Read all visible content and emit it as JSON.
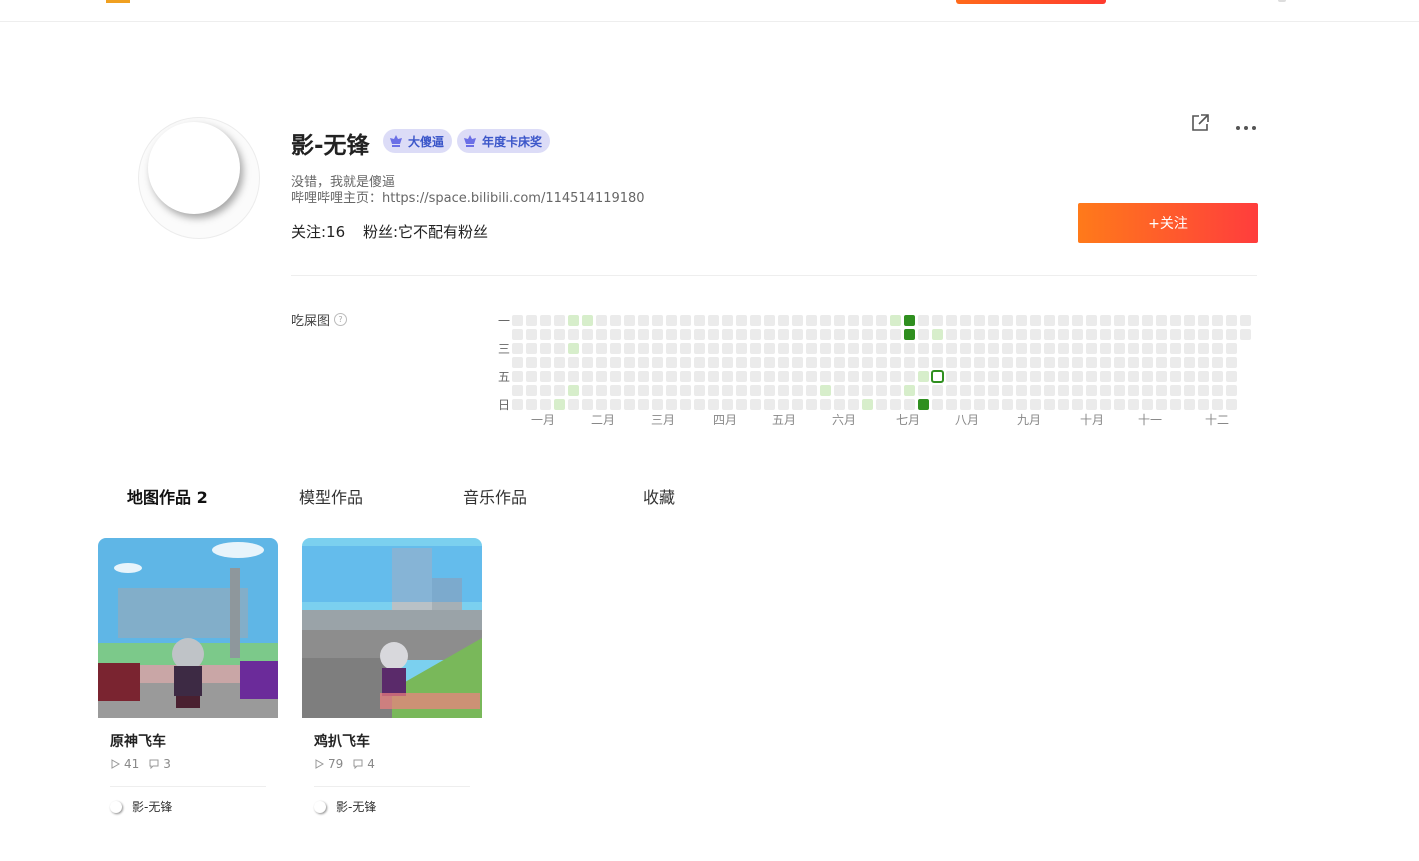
{
  "profile": {
    "username": "影-无锋",
    "badges": [
      "大傻逼",
      "年度卡床奖"
    ],
    "bio": "没错，我就是傻逼",
    "homepage": "哔哩哔哩主页：https://space.bilibili.com/114514119180",
    "following": "关注:16",
    "followers": "粉丝:它不配有粉丝"
  },
  "actions": {
    "follow_label": "+关注",
    "share_icon": "share-icon",
    "more_icon": "more-icon"
  },
  "heatmap": {
    "title": "吃屎图",
    "weekday_labels": [
      "一",
      "三",
      "五",
      "日"
    ],
    "month_labels": [
      "一月",
      "二月",
      "三月",
      "四月",
      "五月",
      "六月",
      "七月",
      "八月",
      "九月",
      "十月",
      "十一",
      "十二"
    ],
    "colors": {
      "empty": "#ebebeb",
      "light": "#d7eecb",
      "dark": "#2f8f1f"
    },
    "cells": [
      {
        "week": 4,
        "day": 0,
        "level": "light"
      },
      {
        "week": 5,
        "day": 0,
        "level": "light"
      },
      {
        "week": 4,
        "day": 2,
        "level": "light"
      },
      {
        "week": 4,
        "day": 5,
        "level": "light"
      },
      {
        "week": 3,
        "day": 6,
        "level": "light"
      },
      {
        "week": 22,
        "day": 5,
        "level": "light"
      },
      {
        "week": 25,
        "day": 6,
        "level": "light"
      },
      {
        "week": 27,
        "day": 0,
        "level": "light"
      },
      {
        "week": 28,
        "day": 0,
        "level": "dark"
      },
      {
        "week": 28,
        "day": 1,
        "level": "dark"
      },
      {
        "week": 30,
        "day": 1,
        "level": "light"
      },
      {
        "week": 29,
        "day": 4,
        "level": "light"
      },
      {
        "week": 30,
        "day": 4,
        "level": "today"
      },
      {
        "week": 28,
        "day": 5,
        "level": "light"
      },
      {
        "week": 29,
        "day": 6,
        "level": "dark"
      }
    ]
  },
  "tabs": [
    "地图作品 2",
    "模型作品",
    "音乐作品",
    "收藏"
  ],
  "works": [
    {
      "title": "原神飞车",
      "plays": "41",
      "comments": "3",
      "author": "影-无锋"
    },
    {
      "title": "鸡扒飞车",
      "plays": "79",
      "comments": "4",
      "author": "影-无锋"
    }
  ]
}
